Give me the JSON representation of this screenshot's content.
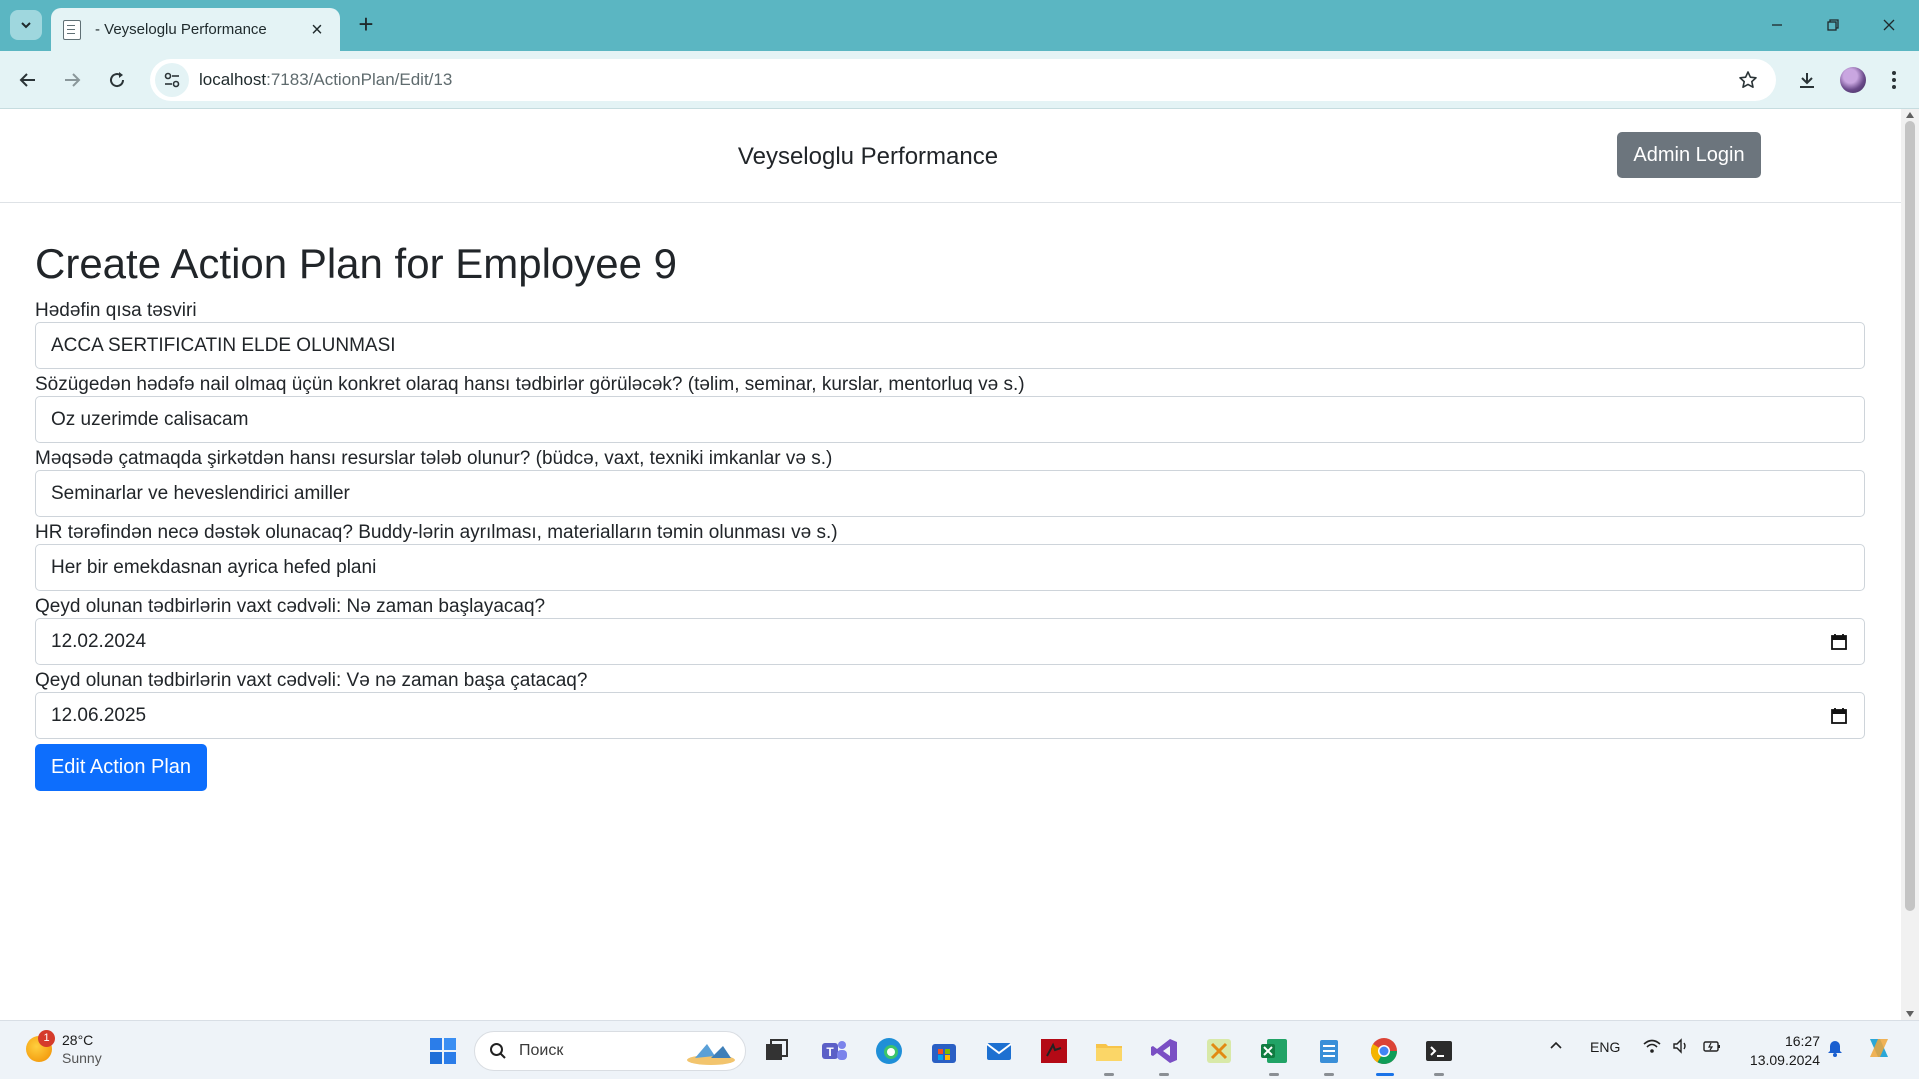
{
  "browser": {
    "tab_title": "- Veyseloglu Performance",
    "url_host": "localhost",
    "url_path": ":7183/ActionPlan/Edit/13"
  },
  "header": {
    "brand": "Veyseloglu Performance",
    "admin_login": "Admin Login"
  },
  "form": {
    "title": "Create Action Plan for Employee 9",
    "fields": [
      {
        "label": "Hədəfin qısa təsviri",
        "value": "ACCA SERTIFICATIN ELDE OLUNMASI"
      },
      {
        "label": "Sözügedən hədəfə nail olmaq üçün konkret olaraq hansı tədbirlər görüləcək? (təlim, seminar, kurslar, mentorluq və s.)",
        "value": "Oz uzerimde calisacam"
      },
      {
        "label": "Məqsədə çatmaqda şirkətdən hansı resurslar tələb olunur? (büdcə, vaxt, texniki imkanlar və s.)",
        "value": "Seminarlar ve heveslendirici amiller"
      },
      {
        "label": "HR tərəfindən necə dəstək olunacaq? Buddy-lərin ayrılması, materialların təmin olunması və s.)",
        "value": "Her bir emekdasnan ayrica hefed plani"
      },
      {
        "label": "Qeyd olunan tədbirlərin vaxt cədvəli: Nə zaman başlayacaq?",
        "value": "12.02.2024"
      },
      {
        "label": "Qeyd olunan tədbirlərin vaxt cədvəli: Və nə zaman başa çatacaq?",
        "value": "12.06.2025"
      }
    ],
    "submit": "Edit Action Plan"
  },
  "taskbar": {
    "weather_temp": "28°C",
    "weather_cond": "Sunny",
    "weather_badge": "1",
    "search_placeholder": "Поиск",
    "lang": "ENG",
    "time": "16:27",
    "date": "13.09.2024"
  }
}
